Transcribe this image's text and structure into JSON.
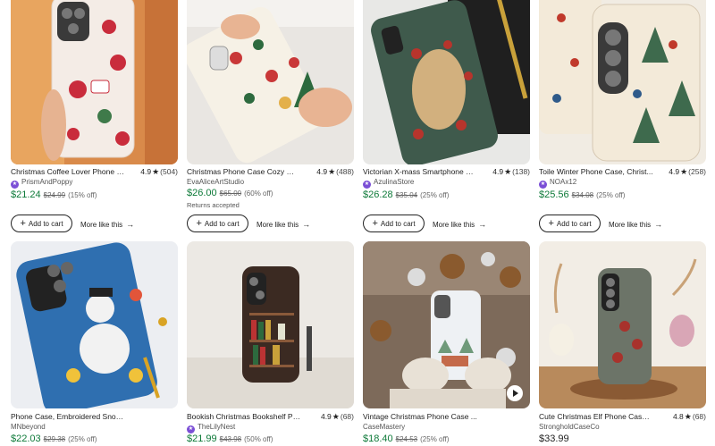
{
  "listings": [
    {
      "title": "Christmas Coffee Lover Phone C...",
      "rating": "4.9",
      "reviews": "(504)",
      "shop": "PrismAndPoppy",
      "star_seller": true,
      "price": "$21.24",
      "original_price": "$24.99",
      "discount": "(15% off)",
      "add_to_cart": "Add to cart",
      "more_like_this": "More like this",
      "image": "phone-case-photo"
    },
    {
      "title": "Christmas Phone Case Cozy Win...",
      "rating": "4.9",
      "reviews": "(488)",
      "shop": "EvaAliceArtStudio",
      "star_seller": false,
      "price": "$26.00",
      "original_price": "$65.00",
      "discount": "(60% off)",
      "note": "Returns accepted",
      "add_to_cart": "Add to cart",
      "more_like_this": "More like this",
      "image": "phone-case-photo"
    },
    {
      "title": "Victorian X-mass Smartphone C...",
      "rating": "4.9",
      "reviews": "(138)",
      "shop": "AzulinaStore",
      "star_seller": true,
      "price": "$26.28",
      "original_price": "$35.04",
      "discount": "(25% off)",
      "add_to_cart": "Add to cart",
      "more_like_this": "More like this",
      "image": "phone-case-photo"
    },
    {
      "title": "Toile Winter Phone Case, Christ...",
      "rating": "4.9",
      "reviews": "(258)",
      "shop": "NOAx12",
      "star_seller": true,
      "price": "$25.56",
      "original_price": "$34.08",
      "discount": "(25% off)",
      "add_to_cart": "Add to cart",
      "more_like_this": "More like this",
      "image": "phone-case-photo"
    },
    {
      "title": "Phone Case, Embroidered Snow...",
      "rating": "",
      "reviews": "",
      "shop": "MNbeyond",
      "star_seller": false,
      "price": "$22.03",
      "original_price": "$29.38",
      "discount": "(25% off)",
      "image": "phone-case-photo"
    },
    {
      "title": "Bookish Christmas Bookshelf Ph...",
      "rating": "4.9",
      "reviews": "(68)",
      "shop": "TheLilyNest",
      "star_seller": true,
      "price": "$21.99",
      "original_price": "$43.98",
      "discount": "(50% off)",
      "image": "phone-case-photo"
    },
    {
      "title": "Vintage Christmas Phone Case ...",
      "rating": "",
      "reviews": "",
      "shop": "CaseMastery",
      "star_seller": false,
      "price": "$18.40",
      "original_price": "$24.53",
      "discount": "(25% off)",
      "image": "phone-case-photo",
      "has_video": true
    },
    {
      "title": "Cute Christmas Elf Phone Case, ...",
      "rating": "4.8",
      "reviews": "(68)",
      "shop": "StrongholdCaseCo",
      "star_seller": false,
      "price": "$33.99",
      "original_price": "",
      "discount": "",
      "image": "phone-case-photo"
    }
  ],
  "colors": {
    "sale_price": "#0e7a39",
    "star_seller_badge": "#7b4fd6",
    "text": "#222222"
  }
}
